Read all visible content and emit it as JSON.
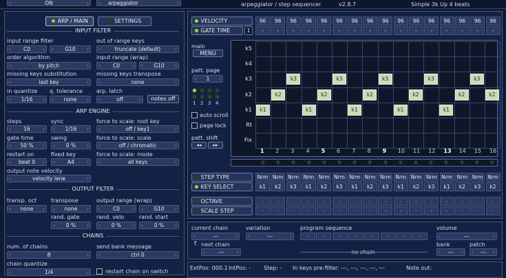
{
  "top": {
    "on_value": "ON",
    "module_value": "arpeggiator",
    "title": "arpeggiator / step sequencer",
    "version": "v2.8.7",
    "preset": "Simple 3k Up 4 beats"
  },
  "tabs": {
    "arp_main": "ARP / MAIN",
    "settings": "SETTINGS"
  },
  "input_filter": {
    "title": "INPUT FILTER",
    "range_label": "input range filter",
    "range_low": "C0",
    "range_high": "G10",
    "oor_label": "out of range keys",
    "oor_value": "truncate (default)",
    "order_label": "order algorithm",
    "order_value": "by pitch",
    "wrap_label": "input range (wrap)",
    "wrap_low": "C0",
    "wrap_high": "G10",
    "missing_label": "missing keys substitution",
    "missing_value": "last key",
    "transpose_label": "missing keys transpose",
    "transpose_value": "none",
    "quantize_label": "in quantize",
    "quantize_value": "1/16",
    "tolerance_label": "q. tolerance",
    "tolerance_value": "none",
    "latch_label": "arp. latch",
    "latch_value": "off",
    "notes_off": "notes off"
  },
  "arp_engine": {
    "title": "ARP ENGINE",
    "steps_label": "steps",
    "steps_value": "16",
    "sync_label": "sync",
    "sync_value": "1/16",
    "fts_root_label": "force to scale: root key",
    "fts_root_value": "off / key1",
    "gate_label": "gate time",
    "gate_value": "50 %",
    "swing_label": "swing",
    "swing_value": "0 %",
    "fts_scale_label": "force to scale: scale",
    "fts_scale_value": "off / chromatic",
    "restart_label": "restart on",
    "restart_value": "beat 0",
    "fixed_label": "fixed key",
    "fixed_value": "A4",
    "fts_mode_label": "force to scale: mode",
    "fts_mode_value": "all keys",
    "velocity_label": "output note velocity",
    "velocity_value": "velocity lane"
  },
  "output_filter": {
    "title": "OUTPUT FILTER",
    "transp_label": "transp. oct",
    "transp_value": "none",
    "transpose_label": "transpose",
    "transpose_value": "none",
    "range_label": "output range (wrap)",
    "range_low": "C0",
    "range_high": "G10",
    "rgate_label": "rand. gate",
    "rgate_value": "0 %",
    "rvelo_label": "rand. velo",
    "rvelo_value": "0 %",
    "rstart_label": "rand. start",
    "rstart_value": "0 %"
  },
  "chains": {
    "title": "CHAINS",
    "num_label": "num. of chains",
    "num_value": "8",
    "bank_label": "send bank message",
    "bank_value": "ctrl 0",
    "quant_label": "chain quantize",
    "quant_value": "1/4",
    "restart_label": "restart chain on switch"
  },
  "lanes": {
    "velocity": "VELOCITY",
    "gate_time": "GATE TIME",
    "gate_num": "1",
    "velocity_values": [
      "96",
      "96",
      "96",
      "96",
      "96",
      "96",
      "96",
      "96",
      "96",
      "96",
      "96",
      "96",
      "96",
      "96",
      "96",
      "96"
    ],
    "gate_values": [
      "-",
      "-",
      "-",
      "-",
      "-",
      "-",
      "-",
      "-",
      "-",
      "-",
      "-",
      "-",
      "-",
      "-",
      "-",
      "-"
    ]
  },
  "left_ctrl": {
    "main_label": "main",
    "menu": "MENU",
    "patt_page": "patt. page",
    "page_value": "1",
    "pages": [
      "1",
      "2",
      "3",
      "4"
    ],
    "auto_scroll": "auto scroll",
    "page_lock": "page lock",
    "patt_shift": "patt. shift",
    "shift_left": "◂◂",
    "shift_right": "▸▸"
  },
  "grid": {
    "rows": [
      "k5",
      "k4",
      "k3",
      "k2",
      "k1",
      "Rt",
      "Fix"
    ],
    "steps": [
      "1",
      "2",
      "3",
      "4",
      "5",
      "6",
      "7",
      "8",
      "9",
      "10",
      "11",
      "12",
      "13",
      "14",
      "15",
      "16"
    ],
    "notes": [
      {
        "step": 1,
        "row": 4,
        "label": "k1"
      },
      {
        "step": 2,
        "row": 3,
        "label": "k2"
      },
      {
        "step": 3,
        "row": 2,
        "label": "k3"
      },
      {
        "step": 4,
        "row": 4,
        "label": "k1"
      },
      {
        "step": 5,
        "row": 3,
        "label": "k2"
      },
      {
        "step": 6,
        "row": 2,
        "label": "k3"
      },
      {
        "step": 7,
        "row": 4,
        "label": "k1"
      },
      {
        "step": 8,
        "row": 3,
        "label": "k2"
      },
      {
        "step": 9,
        "row": 2,
        "label": "k3"
      },
      {
        "step": 10,
        "row": 4,
        "label": "k1"
      },
      {
        "step": 11,
        "row": 3,
        "label": "k2"
      },
      {
        "step": 12,
        "row": 2,
        "label": "k3"
      },
      {
        "step": 13,
        "row": 4,
        "label": "k1"
      },
      {
        "step": 14,
        "row": 3,
        "label": "k2"
      },
      {
        "step": 15,
        "row": 2,
        "label": "k3"
      },
      {
        "step": 16,
        "row": 3,
        "label": "k2"
      }
    ]
  },
  "step_type": {
    "label": "STEP TYPE",
    "values": [
      "Nrm",
      "Nrm",
      "Nrm",
      "Nrm",
      "Nrm",
      "Nrm",
      "Nrm",
      "Nrm",
      "Nrm",
      "Nrm",
      "Nrm",
      "Nrm",
      "Nrm",
      "Nrm",
      "Nrm",
      "Nrm"
    ]
  },
  "key_select": {
    "label": "KEY SELECT",
    "values": [
      "k1",
      "k2",
      "k3",
      "k1",
      "k2",
      "k3",
      "k1",
      "k2",
      "k3",
      "k1",
      "k2",
      "k3",
      "k1",
      "k2",
      "k3",
      "k2"
    ]
  },
  "octave": {
    "label": "OCTAVE"
  },
  "scale_step": {
    "label": "SCALE STEP"
  },
  "bottom": {
    "current_chain": "current chain",
    "current_value": "---",
    "variation": "variation",
    "variation_value": "---",
    "program_sequence": "program sequence",
    "no_chain": "- no chain -",
    "volume": "volume",
    "volume_value": "---",
    "next_chain": "next chain",
    "next_value": "---",
    "bank": "bank",
    "bank_value": "---",
    "patch": "patch",
    "patch_value": "---"
  },
  "status": {
    "extpos": "ExtPos: 000.1",
    "intpos": "IntPos: -",
    "step": "Step: -",
    "inkeys": "In keys pre-filter: ---, ---, ---, ---, ---",
    "noteout": "Note out:"
  }
}
